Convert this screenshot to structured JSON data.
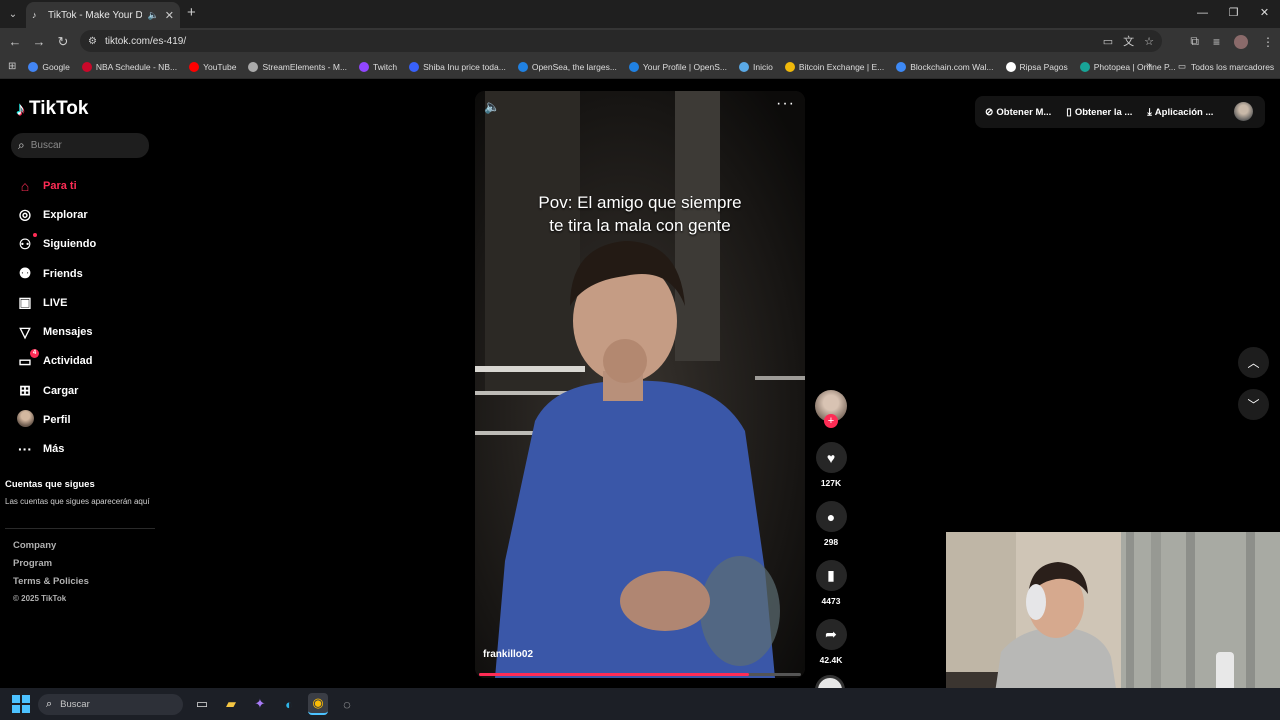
{
  "browser": {
    "tab_title": "TikTok - Make Your Day",
    "url": "tiktok.com/es-419/",
    "bookmarks": [
      {
        "label": "Google",
        "color": "#4285f4"
      },
      {
        "label": "NBA Schedule - NB...",
        "color": "#c9082a"
      },
      {
        "label": "YouTube",
        "color": "#ff0000"
      },
      {
        "label": "StreamElements - M...",
        "color": "#aaaaaa"
      },
      {
        "label": "Twitch",
        "color": "#9146ff"
      },
      {
        "label": "Shiba Inu price toda...",
        "color": "#3861fb"
      },
      {
        "label": "OpenSea, the larges...",
        "color": "#2081e2"
      },
      {
        "label": "Your Profile | OpenS...",
        "color": "#2081e2"
      },
      {
        "label": "Inicio",
        "color": "#5aa9e6"
      },
      {
        "label": "Bitcoin Exchange | E...",
        "color": "#f0b90b"
      },
      {
        "label": "Blockchain.com Wal...",
        "color": "#3d89f5"
      },
      {
        "label": "Ripsa Pagos",
        "color": "#ffffff"
      },
      {
        "label": "Photopea | Online P...",
        "color": "#18a497"
      }
    ],
    "all_bookmarks": "Todos los marcadores"
  },
  "tiktok": {
    "logo": "TikTok",
    "search_placeholder": "Buscar",
    "nav": [
      {
        "label": "Para ti",
        "icon": "home-icon"
      },
      {
        "label": "Explorar",
        "icon": "compass-icon"
      },
      {
        "label": "Siguiendo",
        "icon": "following-icon"
      },
      {
        "label": "Friends",
        "icon": "friends-icon"
      },
      {
        "label": "LIVE",
        "icon": "live-icon"
      },
      {
        "label": "Mensajes",
        "icon": "send-icon"
      },
      {
        "label": "Actividad",
        "icon": "activity-icon",
        "badge": "4"
      },
      {
        "label": "Cargar",
        "icon": "upload-icon"
      },
      {
        "label": "Perfil",
        "icon": "avatar-icon"
      },
      {
        "label": "Más",
        "icon": "more-icon"
      }
    ],
    "following_heading": "Cuentas que sigues",
    "following_text": "Las cuentas que sigues aparecerán aquí",
    "footer": [
      "Company",
      "Program",
      "Terms & Policies"
    ],
    "copyright": "© 2025 TikTok",
    "top_buttons": [
      "Obtener M...",
      "Obtener la ...",
      "Aplicación ..."
    ],
    "video": {
      "caption_line1": "Pov: El amigo que siempre",
      "caption_line2": "te tira la mala con gente",
      "author": "frankillo02",
      "progress": 0.84,
      "likes": "127K",
      "comments": "298",
      "saves": "4473",
      "shares": "42.4K"
    }
  },
  "taskbar": {
    "search_placeholder": "Buscar"
  }
}
